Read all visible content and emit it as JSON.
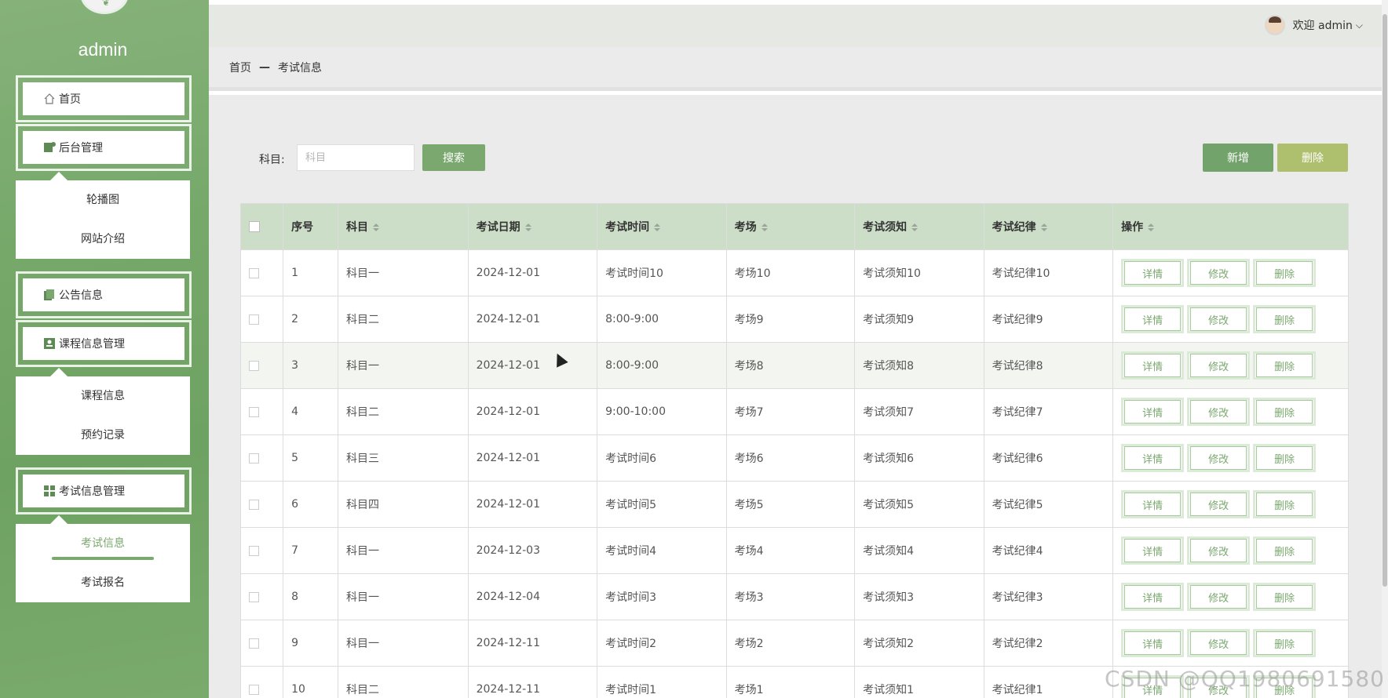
{
  "sidebar": {
    "user_name": "admin",
    "menu": [
      {
        "label": "首页",
        "icon": "home-icon"
      },
      {
        "label": "后台管理",
        "icon": "admin-icon",
        "children": [
          "轮播图",
          "网站介绍"
        ]
      },
      {
        "label": "公告信息",
        "icon": "notice-icon"
      },
      {
        "label": "课程信息管理",
        "icon": "course-icon",
        "children": [
          "课程信息",
          "预约记录"
        ]
      },
      {
        "label": "考试信息管理",
        "icon": "grid-icon",
        "children": [
          "考试信息",
          "考试报名"
        ]
      }
    ]
  },
  "topbar": {
    "welcome": "欢迎 admin"
  },
  "breadcrumb": {
    "home": "首页",
    "separator": "—",
    "current": "考试信息"
  },
  "search": {
    "label": "科目:",
    "placeholder": "科目",
    "button": "搜索"
  },
  "actions": {
    "add": "新增",
    "delete": "删除"
  },
  "table": {
    "headers": [
      "序号",
      "科目",
      "考试日期",
      "考试时间",
      "考场",
      "考试须知",
      "考试纪律",
      "操作"
    ],
    "row_actions": [
      "详情",
      "修改",
      "删除"
    ],
    "rows": [
      [
        "1",
        "科目一",
        "2024-12-01",
        "考试时间10",
        "考场10",
        "考试须知10",
        "考试纪律10"
      ],
      [
        "2",
        "科目二",
        "2024-12-01",
        "8:00-9:00",
        "考场9",
        "考试须知9",
        "考试纪律9"
      ],
      [
        "3",
        "科目一",
        "2024-12-01",
        "8:00-9:00",
        "考场8",
        "考试须知8",
        "考试纪律8"
      ],
      [
        "4",
        "科目二",
        "2024-12-01",
        "9:00-10:00",
        "考场7",
        "考试须知7",
        "考试纪律7"
      ],
      [
        "5",
        "科目三",
        "2024-12-01",
        "考试时间6",
        "考场6",
        "考试须知6",
        "考试纪律6"
      ],
      [
        "6",
        "科目四",
        "2024-12-01",
        "考试时间5",
        "考场5",
        "考试须知5",
        "考试纪律5"
      ],
      [
        "7",
        "科目一",
        "2024-12-03",
        "考试时间4",
        "考场4",
        "考试须知4",
        "考试纪律4"
      ],
      [
        "8",
        "科目一",
        "2024-12-04",
        "考试时间3",
        "考场3",
        "考试须知3",
        "考试纪律3"
      ],
      [
        "9",
        "科目一",
        "2024-12-11",
        "考试时间2",
        "考场2",
        "考试须知2",
        "考试纪律2"
      ],
      [
        "10",
        "科目二",
        "2024-12-11",
        "考试时间1",
        "考场1",
        "考试须知1",
        "考试纪律1"
      ]
    ]
  },
  "watermark": "CSDN @QQ1980691580",
  "colors": {
    "accent": "#7aa86e",
    "header_bg": "#ccdec7",
    "delete_button": "#aebf6d"
  }
}
